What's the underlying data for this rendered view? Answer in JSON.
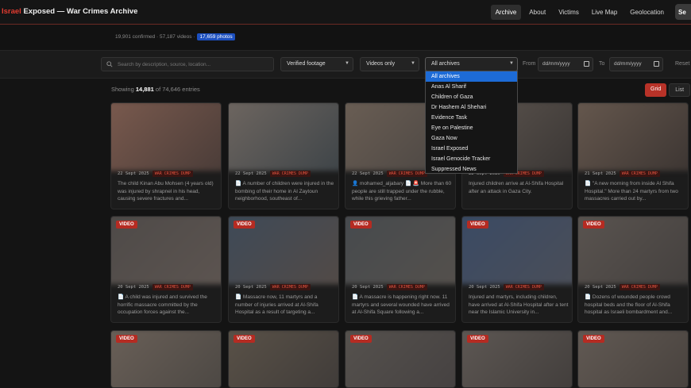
{
  "header": {
    "brand_red": "Israel",
    "brand_rest": " Exposed — War Crimes Archive",
    "nav": [
      "Archive",
      "About",
      "Victims",
      "Live Map",
      "Geolocation"
    ],
    "search_button": "Se"
  },
  "stats": {
    "text": "19,901 confirmed · 57,187 videos ·",
    "highlight": "17,659 photos"
  },
  "filters": {
    "search_placeholder": "Search by description, source, location...",
    "verified": "Verified footage",
    "videos": "Videos only",
    "archive": "All archives",
    "from_label": "From",
    "to_label": "To",
    "from_date": "dd/mm/yyyy",
    "to_date": "dd/mm/yyyy",
    "reset": "Reset"
  },
  "showing": {
    "prefix": "Showing",
    "count": "14,881",
    "suffix": "of 74,646 entries"
  },
  "view": {
    "grid": "Grid",
    "list": "List"
  },
  "dropdown": [
    "All archives",
    "Anas Al Sharif",
    "Children of Gaza",
    "Dr Hashem Al Shehari",
    "Evidence Task",
    "Eye on Palestine",
    "Gaza Now",
    "Israel Exposed",
    "Israel Genocide Tracker",
    "Suppressed News"
  ],
  "cards_row1": [
    {
      "date": "22 Sept 2025",
      "tag": "WAR CRIMES DUMP",
      "desc": "The child Kinan Abu Mohsen (4 years old) was injured by shrapnel in his head, causing severe fractures and...",
      "color1": "#7a5a4e",
      "color2": "#4a3c38"
    },
    {
      "date": "22 Sept 2025",
      "tag": "WAR CRIMES DUMP",
      "desc": "📄 A number of children were injured in the bombing of their home in Al Zaytoun neighborhood, southeast of...",
      "color1": "#6e6660",
      "color2": "#3e4448"
    },
    {
      "date": "22 Sept 2025",
      "tag": "WAR CRIMES DUMP",
      "desc": "👤 mohamed_aljabary 📄 🚨 More than 60 people are still trapped under the rubble, while this grieving father...",
      "color1": "#6a5e54",
      "color2": "#4a4542"
    },
    {
      "date": "22 Sept 2025",
      "tag": "WAR CRIMES DUMP",
      "desc": "Injured children arrive at Al-Shifa Hospital after an attack in Gaza City.",
      "color1": "#5e5650",
      "color2": "#3a3634"
    },
    {
      "date": "21 Sept 2025",
      "tag": "WAR CRIMES DUMP",
      "desc": "📄 \"A new morning from inside Al Shifa Hospital.\" More than 24 martyrs from two massacres carried out by...",
      "color1": "#66584e",
      "color2": "#3c3532"
    }
  ],
  "cards_row2": [
    {
      "badge": "VIDEO",
      "date": "20 Sept 2025",
      "tag": "WAR CRIMES DUMP",
      "desc": "📄 A child was injured and survived the horrific massacre committed by the occupation forces against the...",
      "color1": "#4e4a48",
      "color2": "#5c5450"
    },
    {
      "badge": "VIDEO",
      "date": "20 Sept 2025",
      "tag": "WAR CRIMES DUMP",
      "desc": "📄 Massacre now, 11 martyrs and a number of injuries arrived at Al-Shifa Hospital as a result of targeting a...",
      "color1": "#3e4a58",
      "color2": "#524a46"
    },
    {
      "badge": "VIDEO",
      "date": "20 Sept 2025",
      "tag": "WAR CRIMES DUMP",
      "desc": "📄 A massacre is happening right now. 11 martyrs and several wounded have arrived at Al-Shifa Square following a...",
      "color1": "#464a4e",
      "color2": "#54504c"
    },
    {
      "badge": "VIDEO",
      "date": "20 Sept 2025",
      "tag": "WAR CRIMES DUMP",
      "desc": "Injured and martyrs, including children, have arrived at Al-Shifa Hospital after a tent near the Islamic University in...",
      "color1": "#3a4a64",
      "color2": "#4a4e58"
    },
    {
      "badge": "VIDEO",
      "date": "20 Sept 2025",
      "tag": "WAR CRIMES DUMP",
      "desc": "📄 Dozens of wounded people crowd hospital beds and the floor of Al-Shifa hospital as Israeli bombardment and...",
      "color1": "#5a5450",
      "color2": "#44403e"
    }
  ],
  "cards_row3": [
    {
      "badge": "VIDEO",
      "color1": "#6a6058",
      "color2": "#4a4642"
    },
    {
      "badge": "VIDEO",
      "color1": "#5a5248",
      "color2": "#3e3a38"
    },
    {
      "badge": "VIDEO",
      "color1": "#56524e",
      "color2": "#444040"
    },
    {
      "badge": "VIDEO",
      "color1": "#5e5854",
      "color2": "#403c3a"
    },
    {
      "badge": "VIDEO",
      "color1": "#625a54",
      "color2": "#46403c"
    }
  ]
}
